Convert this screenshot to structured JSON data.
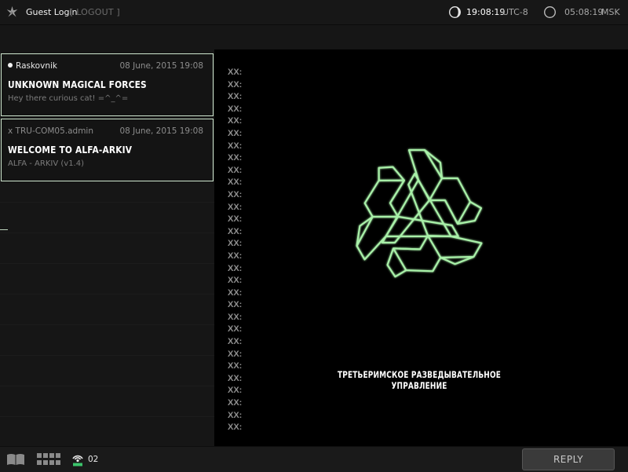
{
  "header": {
    "user_label": "Guest Login",
    "logout_label": "[ LOGOUT ]",
    "clock_local": {
      "time": "19:08:19",
      "zone": "UTC-8"
    },
    "clock_remote": {
      "time": "05:08:19",
      "zone": "MSK"
    }
  },
  "messages": [
    {
      "sender": "Raskovnik",
      "date": "08 June, 2015 19:08",
      "title": "UNKNOWN MAGICAL FORCES",
      "preview": "Hey there curious cat! =^_^="
    },
    {
      "sender": "x TRU-COM05.admin",
      "date": "08 June, 2015 19:08",
      "title": "WELCOME TO ALFA-ARKIV",
      "preview": "ALFA - ARKIV  (v1.4)"
    }
  ],
  "viewer": {
    "row_label": "XX:",
    "agency_name": "ТРЕТЬЕРИМСКОЕ РАЗВЕДЫВАТЕЛЬНОЕ УПРАВЛЕНИЕ",
    "emblem_color": "#a8f0a8"
  },
  "footer": {
    "signal_count": "02",
    "reply_label": "REPLY"
  },
  "icons": [
    "app-logo-icon",
    "moon-clock-icon",
    "circle-clock-icon",
    "book-icon",
    "grid-icon",
    "signal-icon"
  ]
}
